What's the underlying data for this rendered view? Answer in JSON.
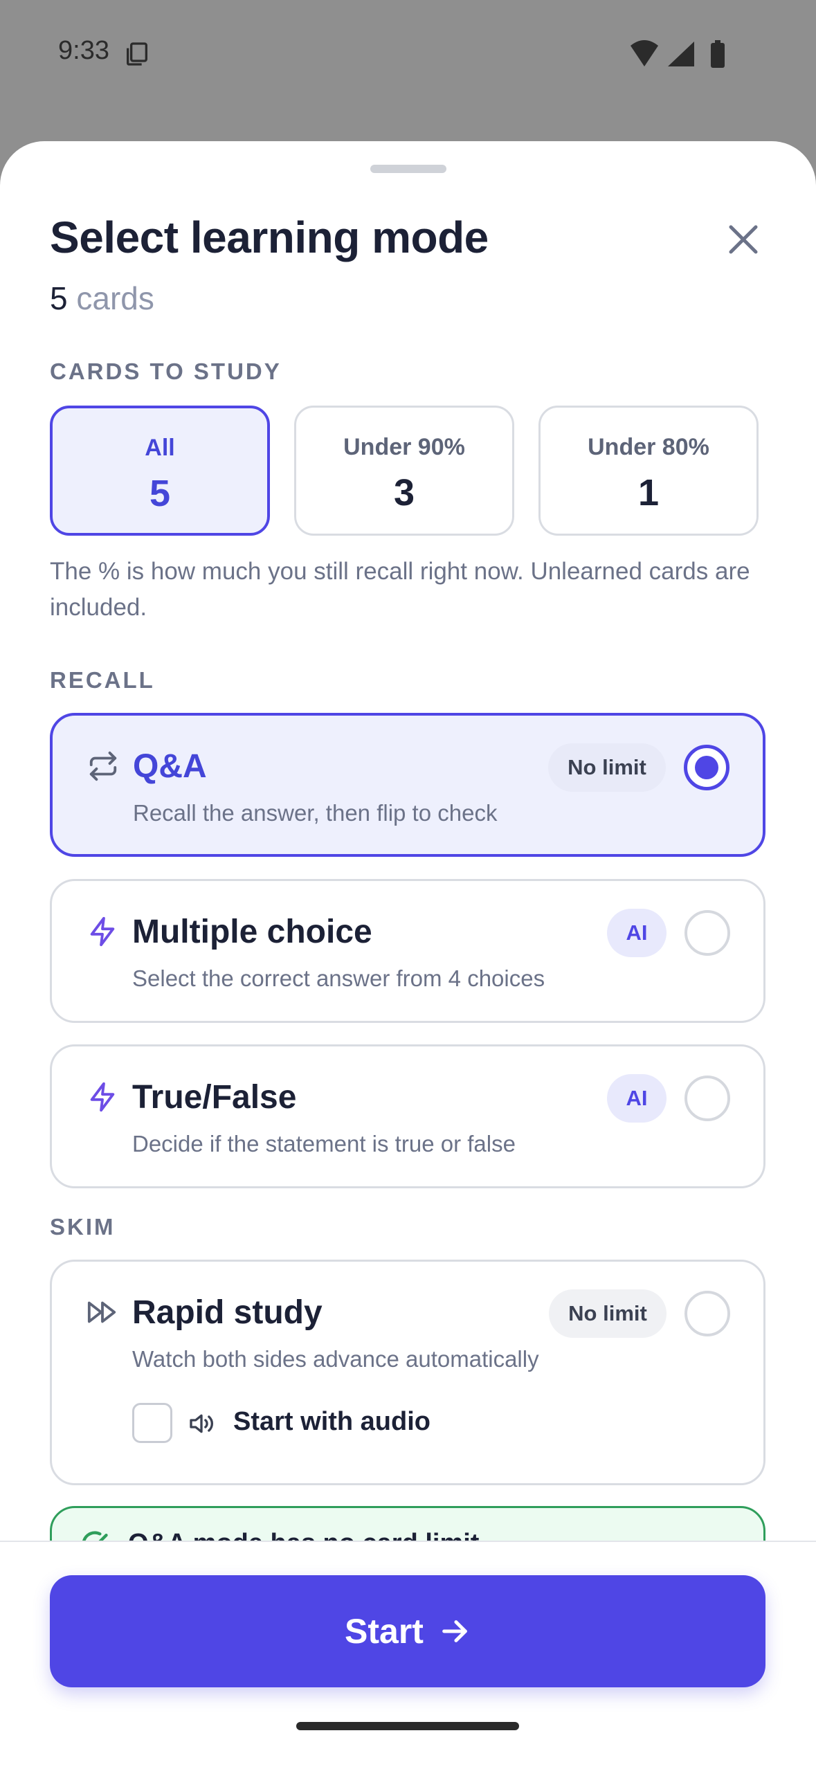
{
  "status_bar": {
    "time": "9:33"
  },
  "sheet": {
    "title": "Select learning mode",
    "card_count": "5",
    "card_count_suffix": " cards"
  },
  "cards_to_study": {
    "label": "CARDS TO STUDY",
    "options": [
      {
        "label": "All",
        "count": "5",
        "selected": true
      },
      {
        "label": "Under 90%",
        "count": "3",
        "selected": false
      },
      {
        "label": "Under 80%",
        "count": "1",
        "selected": false
      }
    ],
    "hint": "The % is how much you still recall right now. Unlearned cards are included."
  },
  "recall": {
    "label": "RECALL",
    "modes": [
      {
        "title": "Q&A",
        "description": "Recall the answer, then flip to check",
        "badge": "No limit",
        "icon": "repeat-icon",
        "selected": true
      },
      {
        "title": "Multiple choice",
        "description": "Select the correct answer from 4 choices",
        "badge": "AI",
        "icon": "lightning-icon",
        "selected": false
      },
      {
        "title": "True/False",
        "description": "Decide if the statement is true or false",
        "badge": "AI",
        "icon": "lightning-icon",
        "selected": false
      }
    ]
  },
  "skim": {
    "label": "SKIM",
    "modes": [
      {
        "title": "Rapid study",
        "description": "Watch both sides advance automatically",
        "badge": "No limit",
        "icon": "fast-forward-icon",
        "selected": false,
        "audio_option": "Start with audio",
        "audio_checked": false
      }
    ]
  },
  "notice": {
    "text": "Q&A mode has no card limit",
    "icon": "check-circle-icon"
  },
  "footer": {
    "start_label": "Start",
    "icon": "arrow-right-icon"
  },
  "colors": {
    "accent": "#4f46e5",
    "accent_light": "#eef0fd",
    "success": "#2f9e5b",
    "text": "#1c2136",
    "muted": "#6b7288"
  }
}
